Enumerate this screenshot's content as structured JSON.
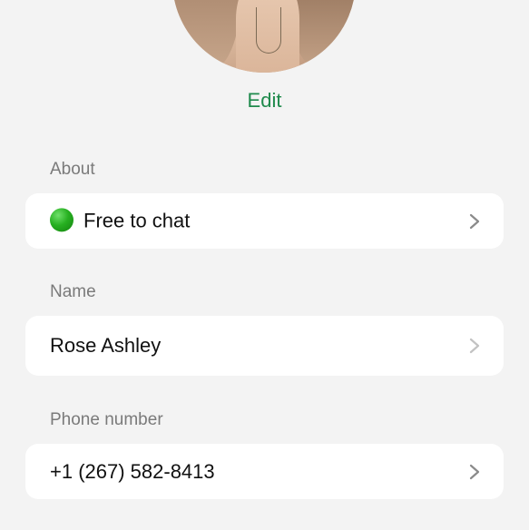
{
  "profile": {
    "edit_label": "Edit"
  },
  "about": {
    "label": "About",
    "value": "Free to chat",
    "status_icon": "green-circle-icon"
  },
  "name": {
    "label": "Name",
    "value": "Rose Ashley"
  },
  "phone": {
    "label": "Phone number",
    "value": "+1 (267) 582-8413"
  },
  "colors": {
    "accent": "#1f8a4c",
    "background": "#f3f3f3",
    "card": "#ffffff",
    "label": "#7a7a7a"
  }
}
